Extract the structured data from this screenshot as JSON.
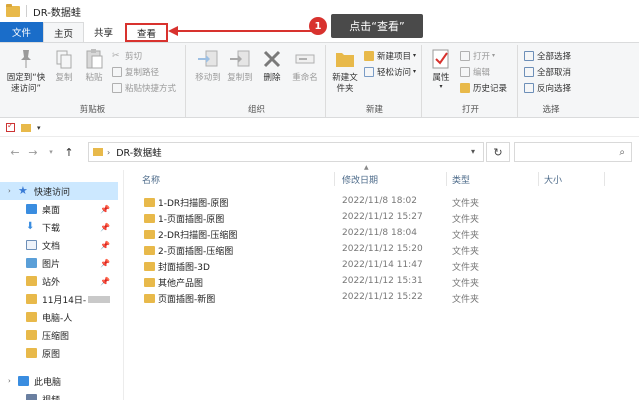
{
  "window": {
    "title": "DR-数据蛙"
  },
  "tabs": {
    "file": "文件",
    "home": "主页",
    "share": "共享",
    "view": "查看"
  },
  "annotation": {
    "step": "1",
    "text": "点击“查看”"
  },
  "ribbon": {
    "clipboard": {
      "label": "剪贴板",
      "pin": "固定到“快速访问”",
      "copy": "复制",
      "paste": "粘贴",
      "cut": "剪切",
      "copy_path": "复制路径",
      "paste_shortcut": "粘贴快捷方式"
    },
    "organize": {
      "label": "组织",
      "move_to": "移动到",
      "copy_to": "复制到",
      "delete": "删除",
      "rename": "重命名"
    },
    "new": {
      "label": "新建",
      "new_folder": "新建文件夹",
      "new_item": "新建项目",
      "easy_access": "轻松访问"
    },
    "open": {
      "label": "打开",
      "properties": "属性",
      "open": "打开",
      "edit": "编辑",
      "history": "历史记录"
    },
    "select": {
      "label": "选择",
      "select_all": "全部选择",
      "select_none": "全部取消",
      "invert": "反向选择"
    }
  },
  "address": {
    "path": "DR-数据蛙"
  },
  "columns": {
    "name": "名称",
    "modified": "修改日期",
    "type": "类型",
    "size": "大小"
  },
  "nav": {
    "quick_access": "快速访问",
    "items": [
      {
        "label": "桌面",
        "pinned": true
      },
      {
        "label": "下载",
        "pinned": true
      },
      {
        "label": "文档",
        "pinned": true
      },
      {
        "label": "图片",
        "pinned": true
      },
      {
        "label": "站外",
        "pinned": true
      },
      {
        "label": "11月14日-",
        "pinned": false
      },
      {
        "label": "电脑-人",
        "pinned": false
      },
      {
        "label": "压缩图",
        "pinned": false
      },
      {
        "label": "原图",
        "pinned": false
      }
    ],
    "this_pc": "此电脑",
    "video": "视频"
  },
  "files": [
    {
      "name": "1-DR扫描图-原图",
      "date": "2022/11/8 18:02",
      "type": "文件夹"
    },
    {
      "name": "1-页面插图-原图",
      "date": "2022/11/12 15:27",
      "type": "文件夹"
    },
    {
      "name": "2-DR扫描图-压缩图",
      "date": "2022/11/8 18:04",
      "type": "文件夹"
    },
    {
      "name": "2-页面插图-压缩图",
      "date": "2022/11/12 15:20",
      "type": "文件夹"
    },
    {
      "name": "封面插图-3D",
      "date": "2022/11/14 11:47",
      "type": "文件夹"
    },
    {
      "name": "其他产品图",
      "date": "2022/11/12 15:31",
      "type": "文件夹"
    },
    {
      "name": "页面插图-新图",
      "date": "2022/11/12 15:22",
      "type": "文件夹"
    }
  ],
  "colors": {
    "accent": "#1a6dc9",
    "highlight": "#d8322e",
    "folder": "#e8b94a",
    "selection": "#cce8ff"
  }
}
